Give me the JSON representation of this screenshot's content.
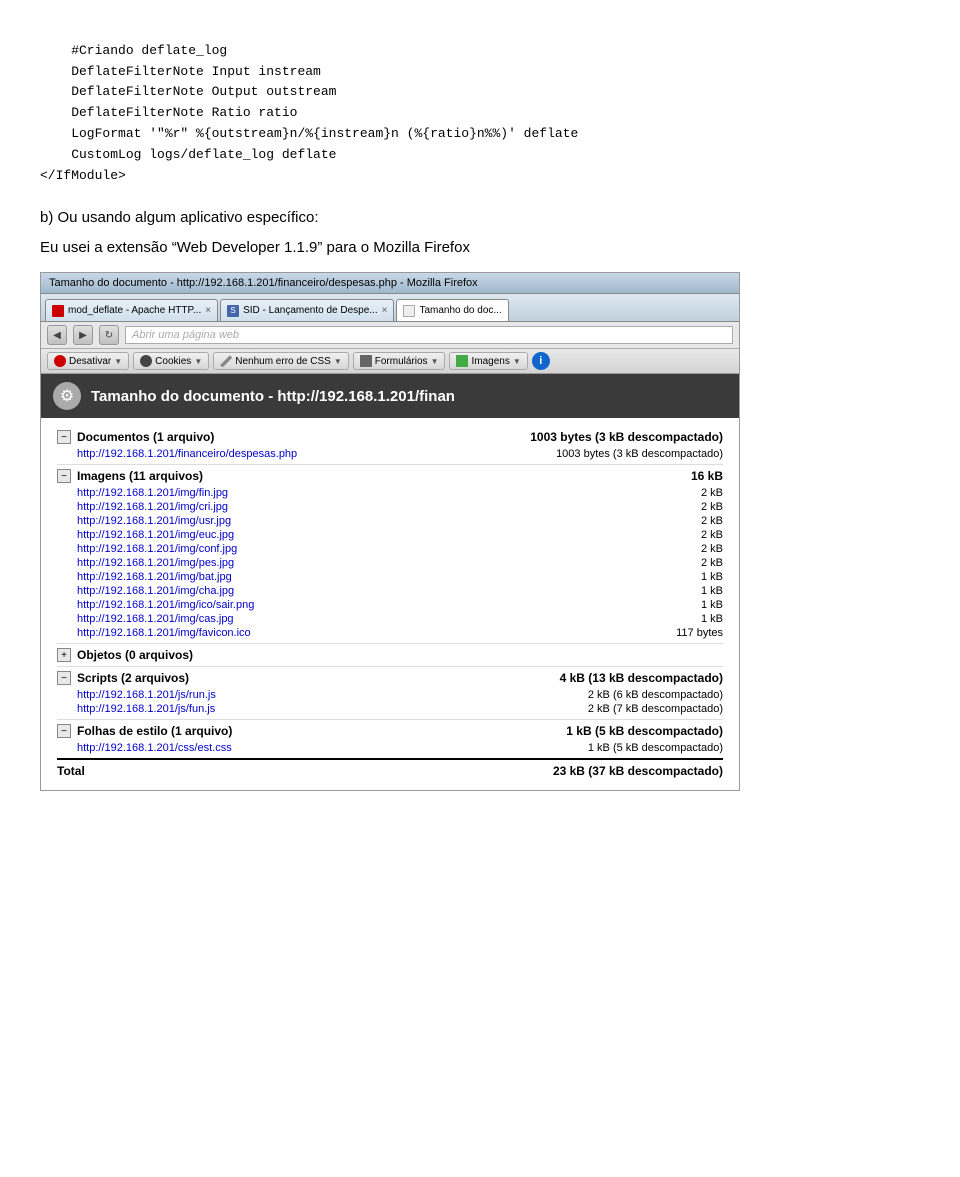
{
  "code": {
    "lines": [
      "    #Criando deflate_log",
      "    DeflateFilterNote Input instream",
      "    DeflateFilterNote Output outstream",
      "    DeflateFilterNote Ratio ratio",
      "    LogFormat '\"%r\" %{outstream}n/%{instream}n (%{ratio}n%%)' deflate",
      "    CustomLog logs/deflate_log deflate",
      "</IfModule>"
    ]
  },
  "section_b": {
    "line1": "b) Ou usando algum aplicativo específico:",
    "line2": "Eu usei a extensão “Web Developer 1.1.9” para o Mozilla Firefox"
  },
  "firefox": {
    "titlebar": "Tamanho do documento - http://192.168.1.201/financeiro/despesas.php - Mozilla Firefox",
    "tabs": [
      {
        "label": "mod_deflate - Apache HTTP...",
        "active": false,
        "icon": "deflate",
        "close": "×"
      },
      {
        "label": "SID - Lançamento de Despe...",
        "active": false,
        "icon": "sid",
        "close": "×"
      },
      {
        "label": "Tamanho do doc...",
        "active": true,
        "icon": "tamanho",
        "close": ""
      }
    ],
    "addressbar": {
      "url_placeholder": "Abrir uma página web"
    },
    "toolbar": {
      "buttons": [
        {
          "label": "Desativar",
          "icon": "circle",
          "dropdown": true
        },
        {
          "label": "Cookies",
          "icon": "person",
          "dropdown": true
        },
        {
          "label": "Nenhum erro de CSS",
          "icon": "pencil",
          "dropdown": true
        },
        {
          "label": "Formulários",
          "icon": "grid",
          "dropdown": true
        },
        {
          "label": "Imagens",
          "icon": "image",
          "dropdown": true
        }
      ],
      "info_button": "i"
    },
    "doc_header": {
      "title": "Tamanho do documento - http://192.168.1.201/finan"
    },
    "sections": [
      {
        "id": "documentos",
        "expand": "−",
        "title": "Documentos (1 arquivo)",
        "size": "1003 bytes (3 kB descompactado)",
        "items": [
          {
            "link": "http://192.168.1.201/financeiro/despesas.php",
            "size": "1003 bytes (3 kB descompactado)"
          }
        ]
      },
      {
        "id": "imagens",
        "expand": "−",
        "title": "Imagens (11 arquivos)",
        "size": "16 kB",
        "items": [
          {
            "link": "http://192.168.1.201/img/fin.jpg",
            "size": "2 kB"
          },
          {
            "link": "http://192.168.1.201/img/cri.jpg",
            "size": "2 kB"
          },
          {
            "link": "http://192.168.1.201/img/usr.jpg",
            "size": "2 kB"
          },
          {
            "link": "http://192.168.1.201/img/euc.jpg",
            "size": "2 kB"
          },
          {
            "link": "http://192.168.1.201/img/conf.jpg",
            "size": "2 kB"
          },
          {
            "link": "http://192.168.1.201/img/pes.jpg",
            "size": "2 kB"
          },
          {
            "link": "http://192.168.1.201/img/bat.jpg",
            "size": "1 kB"
          },
          {
            "link": "http://192.168.1.201/img/cha.jpg",
            "size": "1 kB"
          },
          {
            "link": "http://192.168.1.201/img/ico/sair.png",
            "size": "1 kB"
          },
          {
            "link": "http://192.168.1.201/img/cas.jpg",
            "size": "1 kB"
          },
          {
            "link": "http://192.168.1.201/img/favicon.ico",
            "size": "117 bytes"
          }
        ]
      },
      {
        "id": "objetos",
        "expand": "+",
        "title": "Objetos (0 arquivos)",
        "size": "",
        "items": []
      },
      {
        "id": "scripts",
        "expand": "−",
        "title": "Scripts (2 arquivos)",
        "size": "4 kB (13 kB descompactado)",
        "items": [
          {
            "link": "http://192.168.1.201/js/run.js",
            "size": "2 kB (6 kB descompactado)"
          },
          {
            "link": "http://192.168.1.201/js/fun.js",
            "size": "2 kB (7 kB descompactado)"
          }
        ]
      },
      {
        "id": "folhas",
        "expand": "−",
        "title": "Folhas de estilo (1 arquivo)",
        "size": "1 kB (5 kB descompactado)",
        "items": [
          {
            "link": "http://192.168.1.201/css/est.css",
            "size": "1 kB (5 kB descompactado)"
          }
        ]
      }
    ],
    "total": {
      "label": "Total",
      "size": "23 kB (37 kB descompactado)"
    }
  }
}
